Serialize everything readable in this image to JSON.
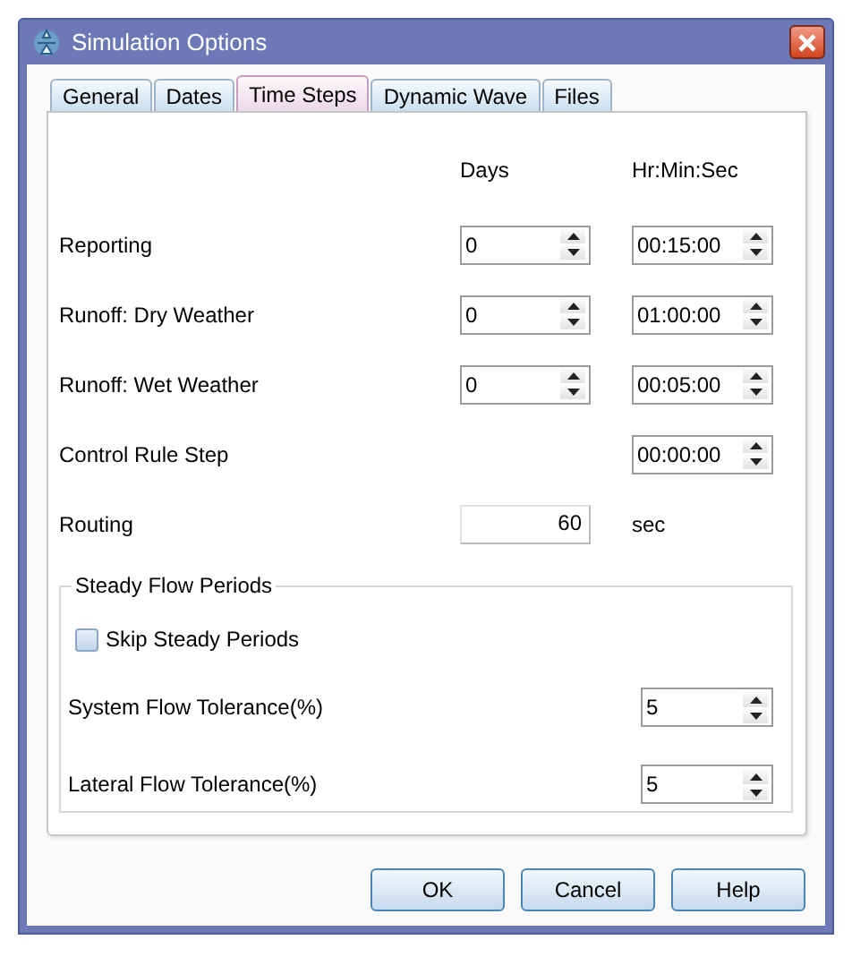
{
  "window": {
    "title": "Simulation Options"
  },
  "tabs": [
    {
      "label": "General",
      "selected": false
    },
    {
      "label": "Dates",
      "selected": false
    },
    {
      "label": "Time Steps",
      "selected": true
    },
    {
      "label": "Dynamic Wave",
      "selected": false
    },
    {
      "label": "Files",
      "selected": false
    }
  ],
  "columns": {
    "days": "Days",
    "time": "Hr:Min:Sec"
  },
  "rows": [
    {
      "kind": "days_time",
      "label": "Reporting",
      "days": "0",
      "time": "00:15:00"
    },
    {
      "kind": "days_time",
      "label": "Runoff: Dry Weather",
      "days": "0",
      "time": "01:00:00"
    },
    {
      "kind": "days_time",
      "label": "Runoff: Wet Weather",
      "days": "0",
      "time": "00:05:00"
    },
    {
      "kind": "time",
      "label": "Control Rule Step",
      "time": "00:00:00"
    },
    {
      "kind": "seconds",
      "label": "Routing",
      "value": "60",
      "unit": "sec"
    }
  ],
  "steady_flow": {
    "title": "Steady Flow Periods",
    "skip": {
      "label": "Skip Steady Periods",
      "checked": false
    },
    "fields": [
      {
        "label": "System Flow Tolerance(%)",
        "value": "5"
      },
      {
        "label": "Lateral Flow Tolerance(%)",
        "value": "5"
      }
    ]
  },
  "buttons": [
    "OK",
    "Cancel",
    "Help"
  ]
}
